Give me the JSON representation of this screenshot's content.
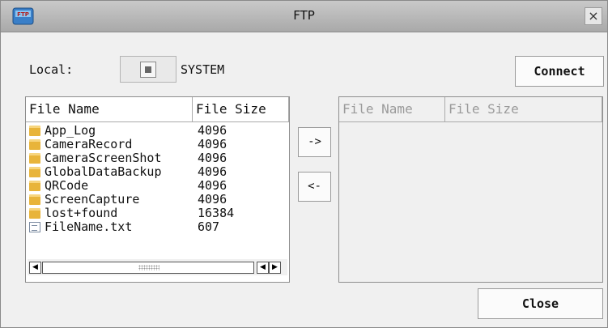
{
  "window": {
    "title": "FTP",
    "close_glyph": "×",
    "app_icon_text": "FTP"
  },
  "local": {
    "label": "Local:",
    "drive_icon": "chip-icon",
    "drive_name": "SYSTEM",
    "connect_label": "Connect"
  },
  "local_files": {
    "columns": [
      "File Name",
      "File Size"
    ],
    "rows": [
      {
        "name": "App_Log",
        "size": "4096",
        "type": "folder"
      },
      {
        "name": "CameraRecord",
        "size": "4096",
        "type": "folder"
      },
      {
        "name": "CameraScreenShot",
        "size": "4096",
        "type": "folder"
      },
      {
        "name": "GlobalDataBackup",
        "size": "4096",
        "type": "folder"
      },
      {
        "name": "QRCode",
        "size": "4096",
        "type": "folder"
      },
      {
        "name": "ScreenCapture",
        "size": "4096",
        "type": "folder"
      },
      {
        "name": "lost+found",
        "size": "16384",
        "type": "folder"
      },
      {
        "name": "FileName.txt",
        "size": "607",
        "type": "file"
      }
    ],
    "scroll_left_glyph": "◀",
    "scroll_right_glyph": "▶"
  },
  "remote_files": {
    "columns": [
      "File Name",
      "File Size"
    ],
    "rows": []
  },
  "transfer": {
    "upload_label": "->",
    "download_label": "<-"
  },
  "footer": {
    "close_label": "Close"
  },
  "colors": {
    "folder": "#e8b43a",
    "titlebar": "#b8b8b8",
    "disabled_header_text": "#9a9a9a"
  }
}
